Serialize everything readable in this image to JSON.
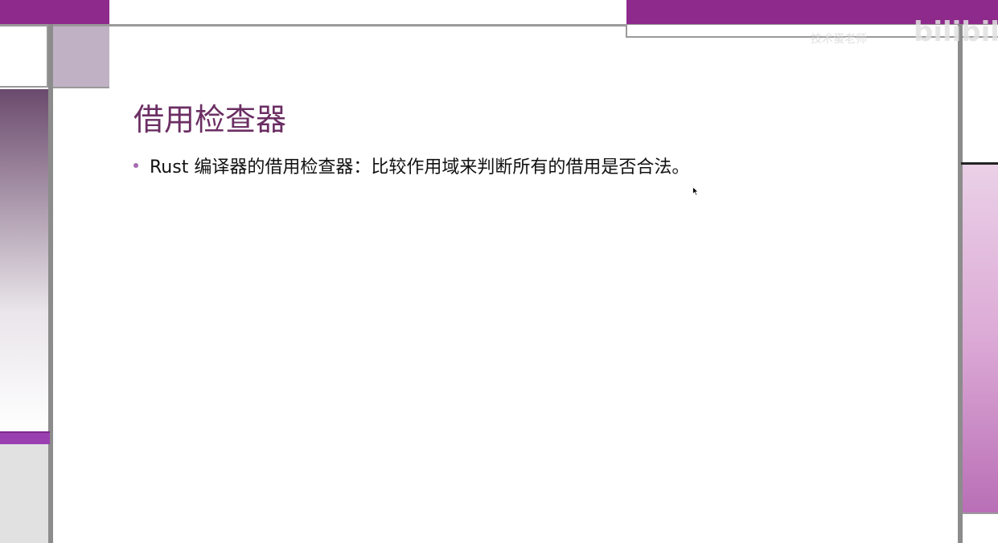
{
  "watermark": {
    "text": "技术蛋老师",
    "logo": "bilibili"
  },
  "slide": {
    "title": "借用检查器",
    "bullets": [
      "Rust 编译器的借用检查器：比较作用域来判断所有的借用是否合法。"
    ]
  },
  "theme": {
    "accent": "#8e2a8b",
    "title_color": "#6b2e63",
    "bullet_color": "#a56bb0"
  }
}
